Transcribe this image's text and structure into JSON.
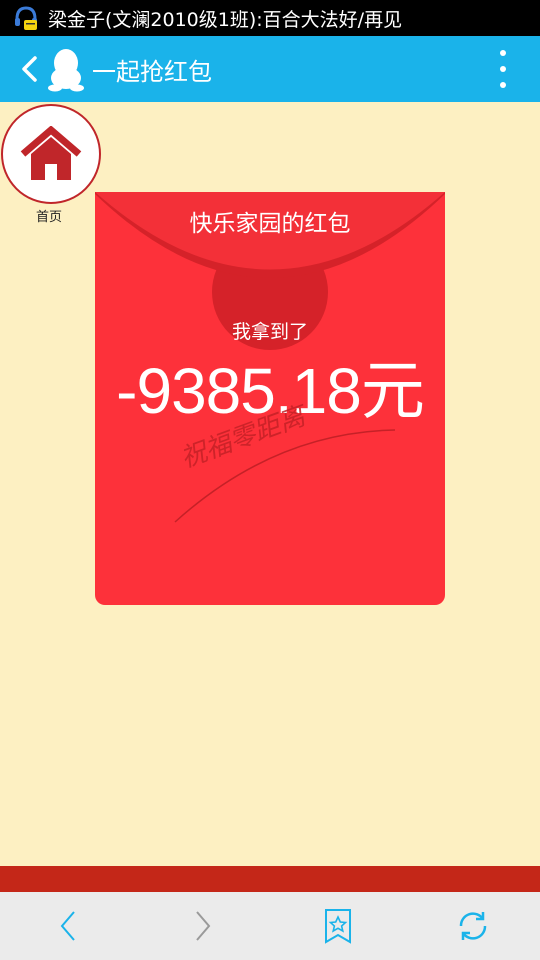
{
  "status_bar": {
    "notification_text": "梁金子(文澜2010级1班):百合大法好/再见",
    "icon": "qq-headset-icon"
  },
  "app_bar": {
    "title": "一起抢红包",
    "back_icon": "chevron-left-icon",
    "logo_icon": "qq-penguin-icon",
    "menu_icon": "more-vertical-icon",
    "color": "#1ab3ea"
  },
  "home": {
    "label": "首页",
    "icon": "home-icon",
    "color": "#c0262a"
  },
  "envelope": {
    "title": "快乐家园的红包",
    "subtitle": "我拿到了",
    "amount": "-9385.18元",
    "signature": "祝福零距离",
    "color": "#fd313a"
  },
  "colors": {
    "background": "#fdf0c2",
    "bottom_strip": "#c42718",
    "nav_icon": "#1ab3ea"
  },
  "bottom_nav": {
    "items": [
      "back-arrow-icon",
      "forward-arrow-icon",
      "bookmark-star-icon",
      "refresh-icon"
    ]
  }
}
